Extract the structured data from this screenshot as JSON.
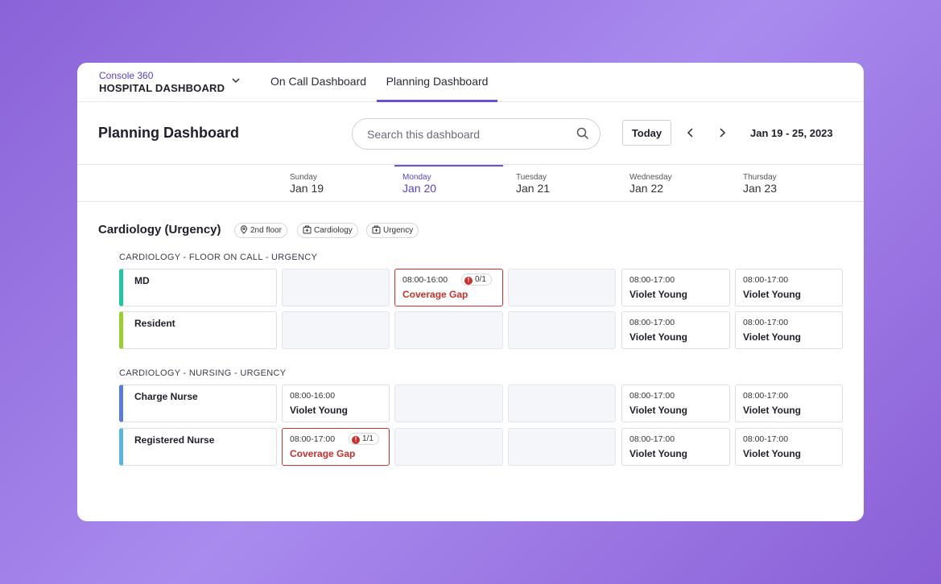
{
  "nav": {
    "brand_sub": "Console 360",
    "brand_title": "HOSPITAL DASHBOARD",
    "tabs": [
      {
        "label": "On Call Dashboard",
        "active": false
      },
      {
        "label": "Planning Dashboard",
        "active": true
      }
    ]
  },
  "header": {
    "title": "Planning Dashboard",
    "search_placeholder": "Search this dashboard",
    "today_label": "Today",
    "date_range": "Jan 19 - 25, 2023"
  },
  "days": [
    {
      "name": "Sunday",
      "date": "Jan 19"
    },
    {
      "name": "Monday",
      "date": "Jan 20",
      "active": true
    },
    {
      "name": "Tuesday",
      "date": "Jan 21"
    },
    {
      "name": "Wednesday",
      "date": "Jan 22"
    },
    {
      "name": "Thursday",
      "date": "Jan 23"
    }
  ],
  "section": {
    "title": "Cardiology (Urgency)",
    "tags": [
      "2nd floor",
      "Cardiology",
      "Urgency"
    ]
  },
  "groups": [
    {
      "title": "CARDIOLOGY - FLOOR ON CALL - URGENCY",
      "rows": [
        {
          "role": "MD",
          "color": "#1fc7a0",
          "cells": [
            {
              "type": "empty"
            },
            {
              "type": "gap",
              "time": "08:00-16:00",
              "label": "Coverage Gap",
              "count": "0/1"
            },
            {
              "type": "empty"
            },
            {
              "type": "shift",
              "time": "08:00-17:00",
              "person": "Violet Young"
            },
            {
              "type": "shift",
              "time": "08:00-17:00",
              "person": "Violet Young"
            }
          ]
        },
        {
          "role": "Resident",
          "color": "#9bcf2f",
          "cells": [
            {
              "type": "empty"
            },
            {
              "type": "empty"
            },
            {
              "type": "empty"
            },
            {
              "type": "shift",
              "time": "08:00-17:00",
              "person": "Violet Young"
            },
            {
              "type": "shift",
              "time": "08:00-17:00",
              "person": "Violet Young"
            }
          ]
        }
      ]
    },
    {
      "title": "CARDIOLOGY - NURSING - URGENCY",
      "rows": [
        {
          "role": "Charge Nurse",
          "color": "#5b7bd8",
          "cells": [
            {
              "type": "shift",
              "time": "08:00-16:00",
              "person": "Violet Young"
            },
            {
              "type": "empty"
            },
            {
              "type": "empty"
            },
            {
              "type": "shift",
              "time": "08:00-17:00",
              "person": "Violet Young"
            },
            {
              "type": "shift",
              "time": "08:00-17:00",
              "person": "Violet Young"
            }
          ]
        },
        {
          "role": "Registered Nurse",
          "color": "#5ab4e0",
          "cells": [
            {
              "type": "gap",
              "time": "08:00-17:00",
              "label": "Coverage Gap",
              "count": "1/1"
            },
            {
              "type": "empty"
            },
            {
              "type": "empty"
            },
            {
              "type": "shift",
              "time": "08:00-17:00",
              "person": "Violet Young"
            },
            {
              "type": "shift",
              "time": "08:00-17:00",
              "person": "Violet Young"
            }
          ]
        }
      ]
    }
  ]
}
